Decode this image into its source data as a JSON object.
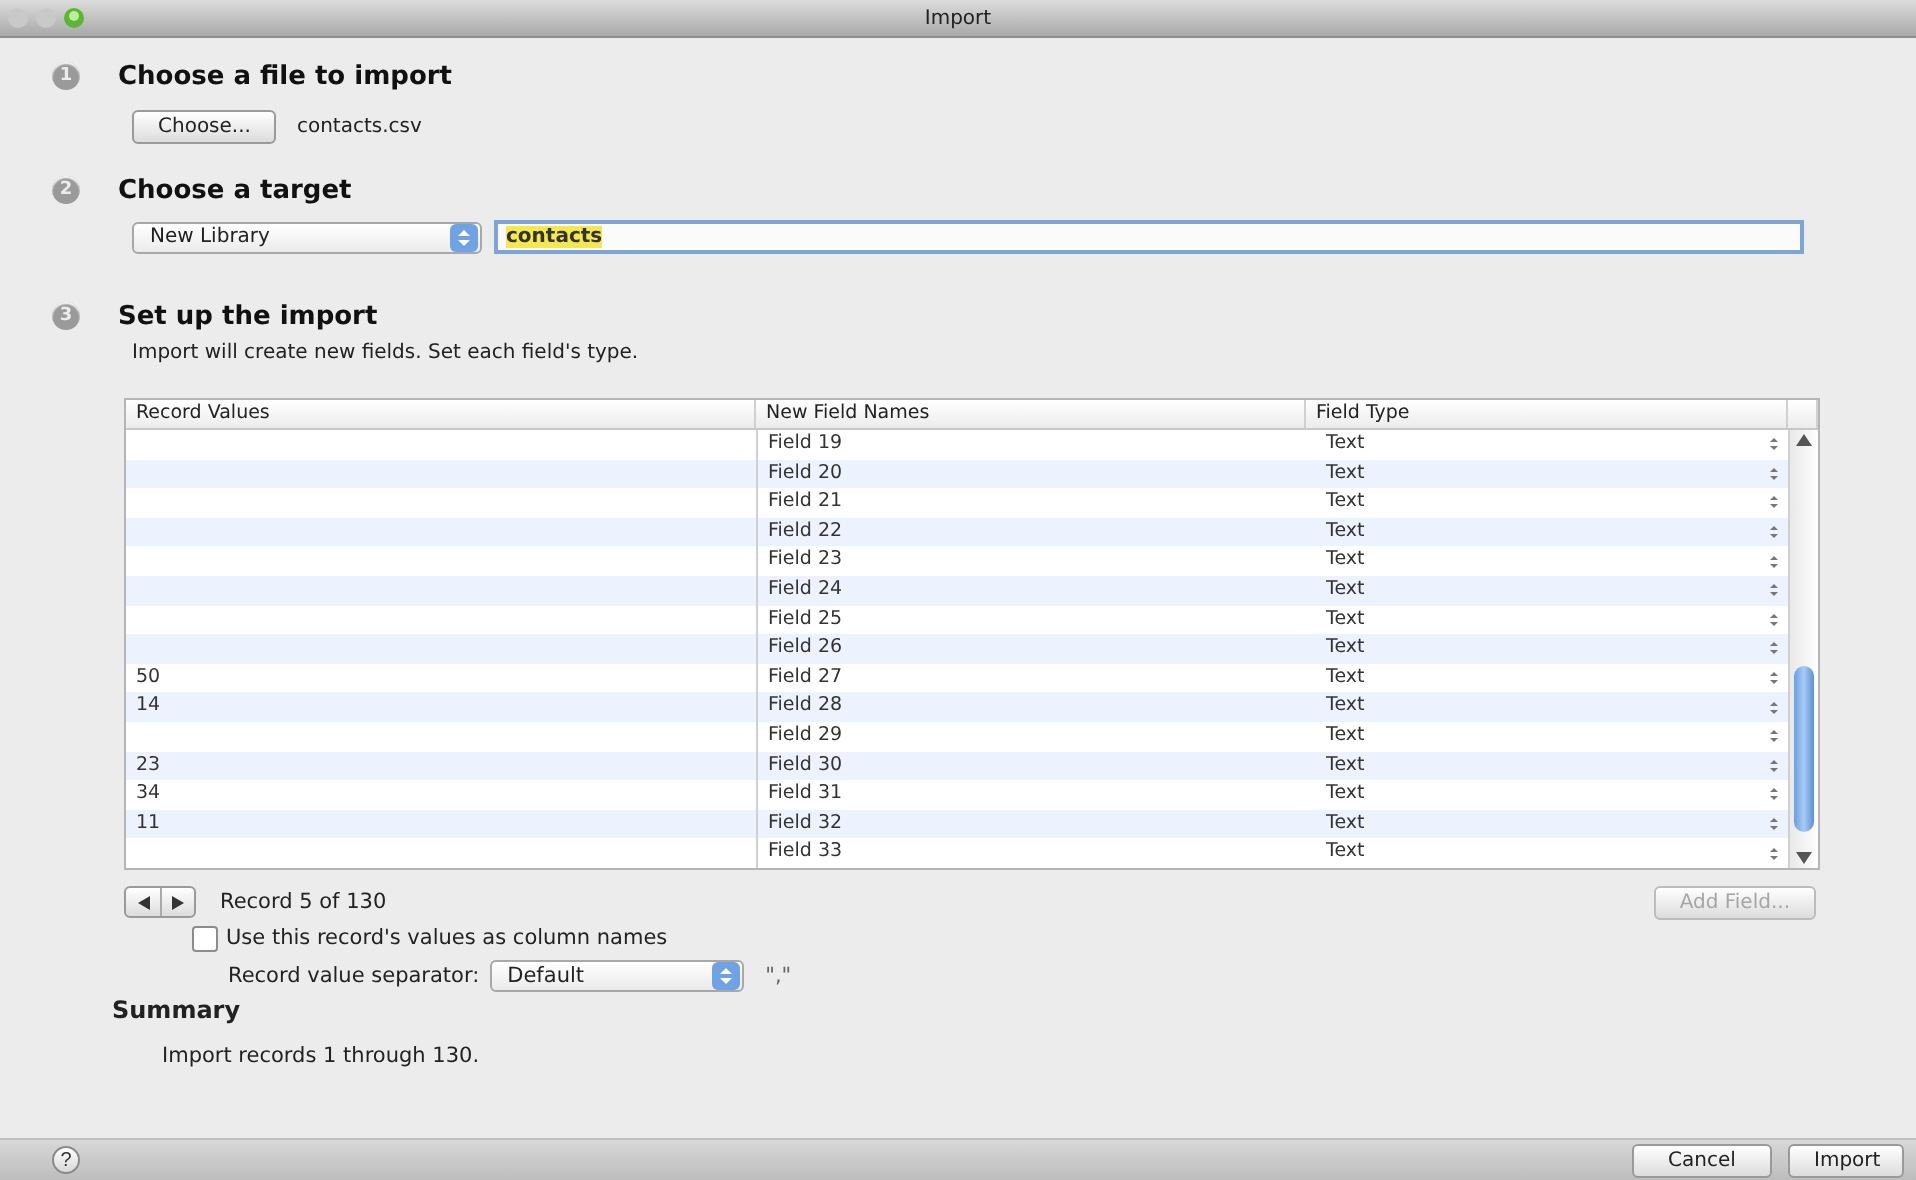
{
  "window": {
    "title": "Import"
  },
  "file_step": {
    "number": "1",
    "title": "Choose a file to import",
    "button": "Choose...",
    "file_name": "contacts.csv"
  },
  "target_step": {
    "number": "2",
    "title": "Choose a target",
    "target_popup": "New Library",
    "name_field": {
      "value": "contacts",
      "highlighted": true
    }
  },
  "setup_step": {
    "number": "3",
    "title": "Set up the import",
    "description": "Import will create new fields. Set each field's type.",
    "table": {
      "columns": [
        "Record Values",
        "New Field Names",
        "Field Type"
      ],
      "rows": [
        {
          "field_name": "Field 19",
          "field_type": "Text"
        },
        {
          "field_name": "Field 20",
          "field_type": "Text"
        },
        {
          "field_name": "Field 21",
          "field_type": "Text"
        },
        {
          "field_name": "Field 22",
          "field_type": "Text"
        },
        {
          "field_name": "Field 23",
          "field_type": "Text"
        },
        {
          "field_name": "Field 24",
          "field_type": "Text"
        },
        {
          "field_name": "Field 25",
          "field_type": "Text"
        },
        {
          "field_name": "Field 26",
          "field_type": "Text"
        },
        {
          "record_value": "50",
          "field_name": "Field 27",
          "field_type": "Text"
        },
        {
          "record_value": "14",
          "field_name": "Field 28",
          "field_type": "Text"
        },
        {
          "field_name": "Field 29",
          "field_type": "Text"
        },
        {
          "record_value": "23",
          "field_name": "Field 30",
          "field_type": "Text"
        },
        {
          "record_value": "34",
          "field_name": "Field 31",
          "field_type": "Text"
        },
        {
          "record_value": "11",
          "field_name": "Field 32",
          "field_type": "Text"
        },
        {
          "field_name": "Field 33",
          "field_type": "Text"
        }
      ]
    },
    "record_nav": "Record 5 of 130",
    "add_field_button": {
      "label": "Add Field...",
      "disabled": true
    },
    "use_as_column_names": {
      "label": "Use this record's values as column names",
      "checked": false
    },
    "separator": {
      "label": "Record value separator:",
      "value": "Default",
      "preview": "\",\""
    }
  },
  "summary": {
    "title": "Summary",
    "text": "Import records 1 through 130."
  },
  "footer": {
    "help": "?",
    "buttons": [
      "Cancel",
      "Import"
    ]
  }
}
